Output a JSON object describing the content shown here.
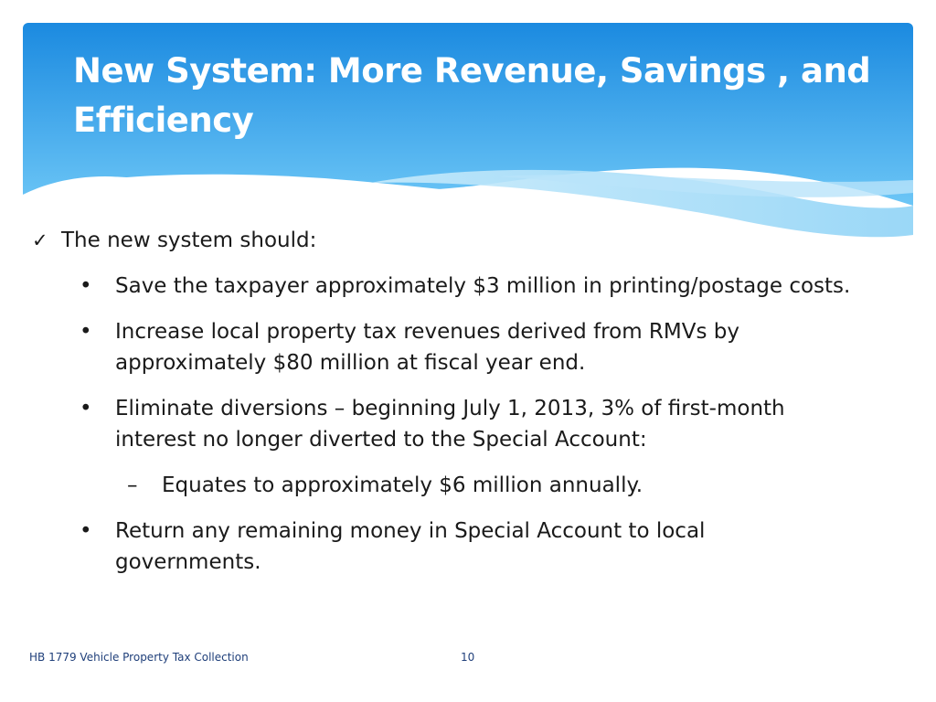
{
  "slide": {
    "title": "New System: More Revenue, Savings , and Efficiency",
    "lead": "The new system should:",
    "bullets": [
      {
        "marker": "•",
        "text": "Save the taxpayer approximately $3 million in printing/postage costs.",
        "level": 1
      },
      {
        "marker": "•",
        "text": "Increase local property tax revenues derived from RMVs by approximately $80 million at fiscal year end.",
        "level": 1
      },
      {
        "marker": "•",
        "text": "Eliminate diversions – beginning July 1, 2013, 3% of first-month interest no longer diverted to the Special Account:",
        "level": 1
      },
      {
        "marker": "–",
        "text": "Equates to approximately $6 million annually.",
        "level": 2
      },
      {
        "marker": "•",
        "text": "Return any remaining money in Special Account to local governments.",
        "level": 1
      }
    ],
    "check_glyph": "✓",
    "footer_text": "HB 1779 Vehicle Property Tax Collection",
    "page_number": "10"
  },
  "colors": {
    "header_top": "#1e8fe0",
    "header_bottom": "#5cc0f5",
    "wave_light": "#a8dcf7",
    "footer_text": "#1f3f7a"
  }
}
